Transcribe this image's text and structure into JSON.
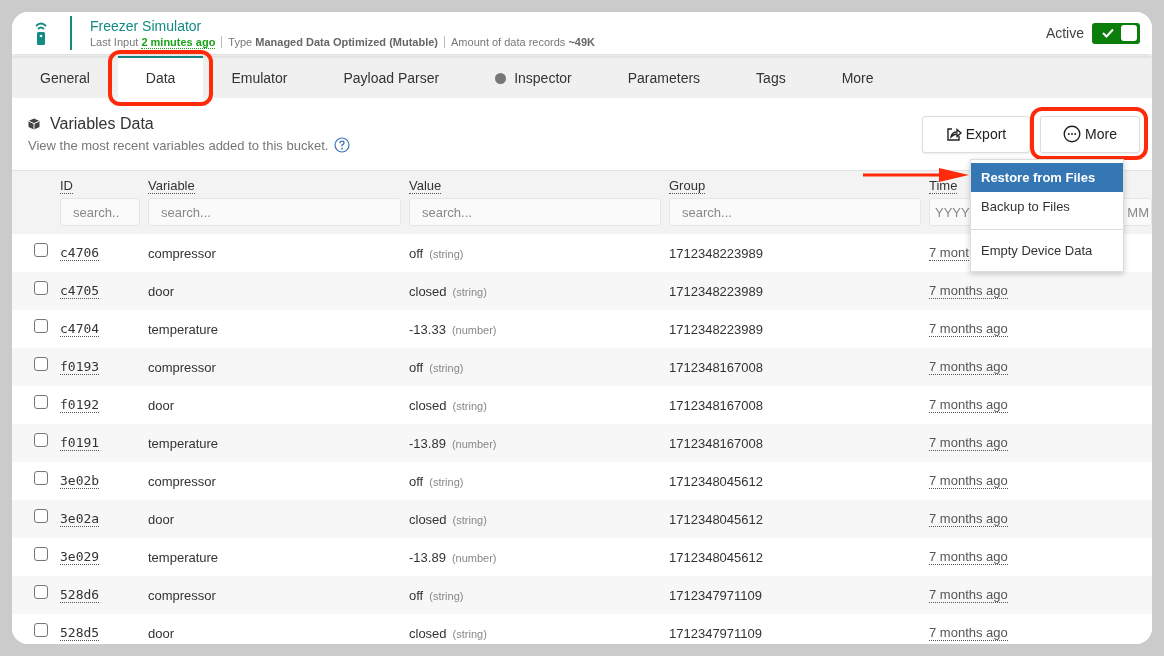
{
  "header": {
    "title": "Freezer Simulator",
    "meta": [
      {
        "label": "Last Input",
        "value": "2 minutes ago",
        "kind": "time"
      },
      {
        "label": "Type",
        "value": "Managed Data Optimized (Mutable)",
        "kind": "plain"
      },
      {
        "label": "Amount of data records",
        "value": "~49K",
        "kind": "plain"
      }
    ],
    "active": {
      "label": "Active",
      "on": true
    }
  },
  "tabs": [
    {
      "label": "General",
      "selected": false,
      "circled": false,
      "dot": false
    },
    {
      "label": "Data",
      "selected": true,
      "circled": true,
      "dot": false
    },
    {
      "label": "Emulator",
      "selected": false,
      "circled": false,
      "dot": false
    },
    {
      "label": "Payload Parser",
      "selected": false,
      "circled": false,
      "dot": false
    },
    {
      "label": "Inspector",
      "selected": false,
      "circled": false,
      "dot": true
    },
    {
      "label": "Parameters",
      "selected": false,
      "circled": false,
      "dot": false
    },
    {
      "label": "Tags",
      "selected": false,
      "circled": false,
      "dot": false
    },
    {
      "label": "More",
      "selected": false,
      "circled": false,
      "dot": false
    }
  ],
  "section": {
    "title": "Variables Data",
    "subtitle": "View the most recent variables added to this bucket.",
    "export_button": "Export",
    "more_button": {
      "label": "More",
      "circled": true
    },
    "menu": {
      "pointer_arrow": true,
      "items": [
        {
          "label": "Restore from Files",
          "selected": true,
          "divider_before": false
        },
        {
          "label": "Backup to Files",
          "selected": false,
          "divider_before": false
        },
        {
          "label": "Empty Device Data",
          "selected": false,
          "divider_before": true
        }
      ]
    }
  },
  "table": {
    "columns": [
      {
        "label": "ID",
        "placeholder": "search.."
      },
      {
        "label": "Variable",
        "placeholder": "search..."
      },
      {
        "label": "Value",
        "placeholder": "search..."
      },
      {
        "label": "Group",
        "placeholder": "search..."
      },
      {
        "label": "Time",
        "placeholder": "YYYY",
        "placeholder_end": "MM"
      }
    ],
    "rows": [
      {
        "checked": false,
        "id": "c4706",
        "variable": "compressor",
        "value": "off",
        "type": "(string)",
        "group": "1712348223989",
        "time": "7 mont"
      },
      {
        "checked": false,
        "id": "c4705",
        "variable": "door",
        "value": "closed",
        "type": "(string)",
        "group": "1712348223989",
        "time": "7 months ago"
      },
      {
        "checked": false,
        "id": "c4704",
        "variable": "temperature",
        "value": "-13.33",
        "type": "(number)",
        "group": "1712348223989",
        "time": "7 months ago"
      },
      {
        "checked": false,
        "id": "f0193",
        "variable": "compressor",
        "value": "off",
        "type": "(string)",
        "group": "1712348167008",
        "time": "7 months ago"
      },
      {
        "checked": false,
        "id": "f0192",
        "variable": "door",
        "value": "closed",
        "type": "(string)",
        "group": "1712348167008",
        "time": "7 months ago"
      },
      {
        "checked": false,
        "id": "f0191",
        "variable": "temperature",
        "value": "-13.89",
        "type": "(number)",
        "group": "1712348167008",
        "time": "7 months ago"
      },
      {
        "checked": false,
        "id": "3e02b",
        "variable": "compressor",
        "value": "off",
        "type": "(string)",
        "group": "1712348045612",
        "time": "7 months ago"
      },
      {
        "checked": false,
        "id": "3e02a",
        "variable": "door",
        "value": "closed",
        "type": "(string)",
        "group": "1712348045612",
        "time": "7 months ago"
      },
      {
        "checked": false,
        "id": "3e029",
        "variable": "temperature",
        "value": "-13.89",
        "type": "(number)",
        "group": "1712348045612",
        "time": "7 months ago"
      },
      {
        "checked": false,
        "id": "528d6",
        "variable": "compressor",
        "value": "off",
        "type": "(string)",
        "group": "1712347971109",
        "time": "7 months ago"
      },
      {
        "checked": false,
        "id": "528d5",
        "variable": "door",
        "value": "closed",
        "type": "(string)",
        "group": "1712347971109",
        "time": "7 months ago"
      }
    ]
  }
}
